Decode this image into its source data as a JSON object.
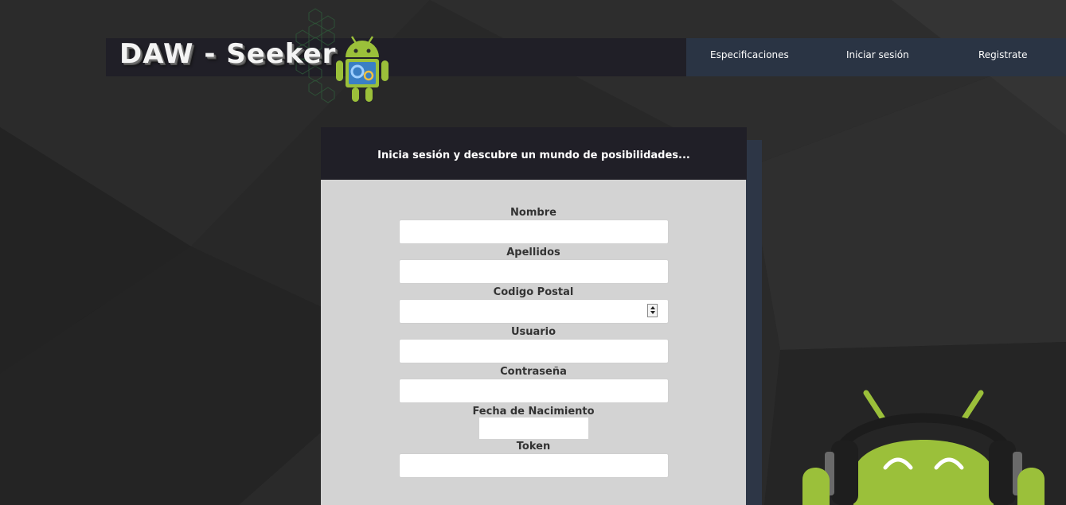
{
  "header": {
    "logo_text": "DAW - Seeker",
    "nav": [
      {
        "label": "Especificaciones"
      },
      {
        "label": "Iniciar sesión"
      },
      {
        "label": "Registrate"
      }
    ]
  },
  "form": {
    "heading": "Inicia sesión y descubre un mundo de posibilidades...",
    "fields": [
      {
        "label": "Nombre",
        "value": ""
      },
      {
        "label": "Apellidos",
        "value": ""
      },
      {
        "label": "Codigo Postal",
        "value": ""
      },
      {
        "label": "Usuario",
        "value": ""
      },
      {
        "label": "Contraseña",
        "value": ""
      },
      {
        "label": "Fecha de Nacimiento",
        "value": ""
      },
      {
        "label": "Token",
        "value": ""
      }
    ]
  },
  "icons": {
    "logo": "android-gears-robot-icon",
    "mascot": "android-headphones-icon"
  },
  "colors": {
    "background": "#262626",
    "header_bar": "#201f27",
    "nav_bar": "#2a3444",
    "form_body": "#d3d3d3",
    "android_green": "#9bc03a"
  }
}
